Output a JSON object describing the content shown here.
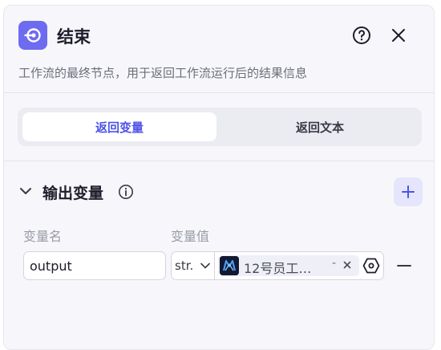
{
  "header": {
    "title": "结束",
    "node_icon": "end-node-icon",
    "help_icon": "help-circle-icon",
    "close_icon": "close-icon"
  },
  "description": "工作流的最终节点，用于返回工作流运行后的结果信息",
  "tabs": [
    {
      "label": "返回变量",
      "active": true
    },
    {
      "label": "返回文本",
      "active": false
    }
  ],
  "section": {
    "title": "输出变量",
    "info_icon": "info-icon",
    "add_icon": "plus-icon"
  },
  "columns": {
    "name_label": "变量名",
    "value_label": "变量值"
  },
  "variables": [
    {
      "name": "output",
      "type": "str.",
      "reference": "12号员工…",
      "reference_suffix": "-"
    }
  ],
  "colors": {
    "accent": "#4d53e8",
    "node_icon_bg": "#6d6bf0",
    "panel_bg": "#f7f7fb"
  }
}
